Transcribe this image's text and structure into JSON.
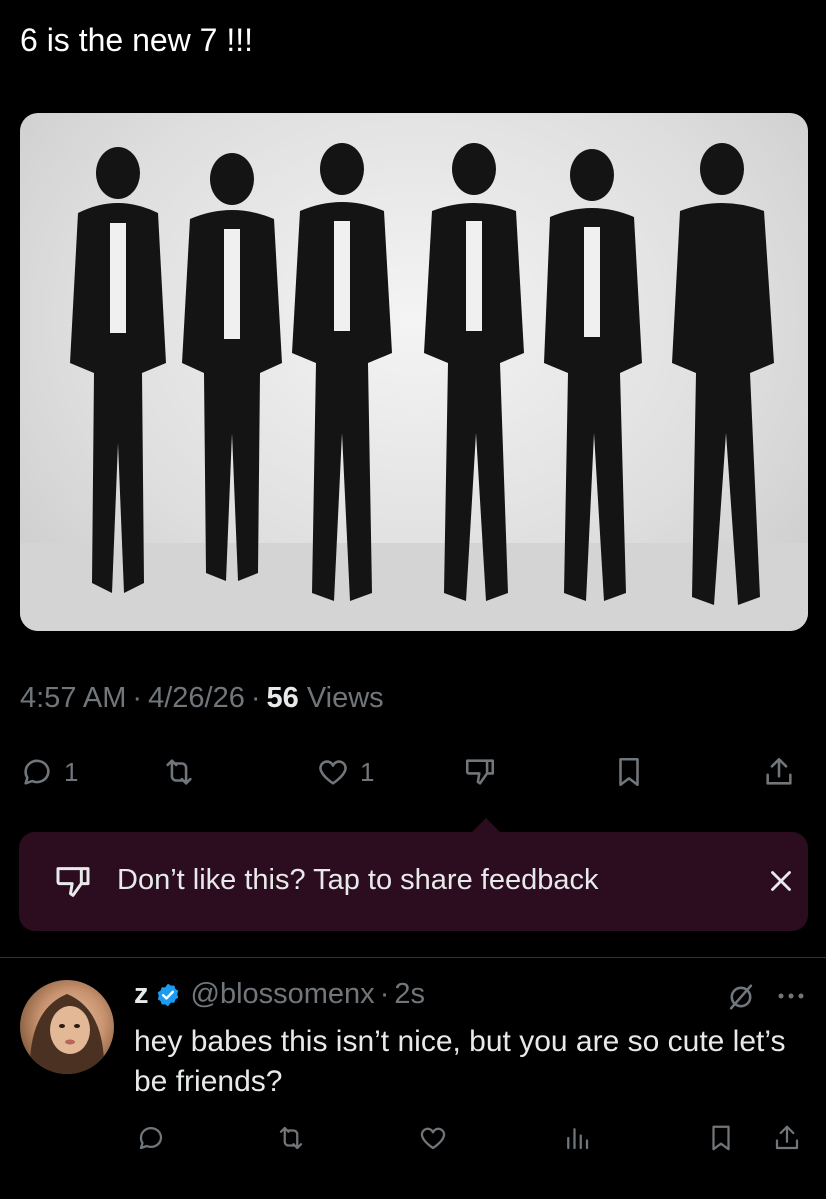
{
  "tweet": {
    "text": "6 is the new 7 !!!"
  },
  "meta": {
    "time": "4:57 AM",
    "date": "4/26/26",
    "views_count": "56",
    "views_label": "Views"
  },
  "actions": {
    "reply_count": "1",
    "like_count": "1"
  },
  "feedback": {
    "text": "Don’t like this? Tap to share feedback",
    "accent": "#2b0d1f"
  },
  "reply": {
    "name": "z",
    "handle": "@blossomenx",
    "time": "2s",
    "text": "hey babes this isn’t nice, but you are so cute let’s be friends?"
  },
  "colors": {
    "background": "#000000",
    "muted": "#71767b",
    "text": "#e7e9ea",
    "verified": "#1d9bf0"
  }
}
